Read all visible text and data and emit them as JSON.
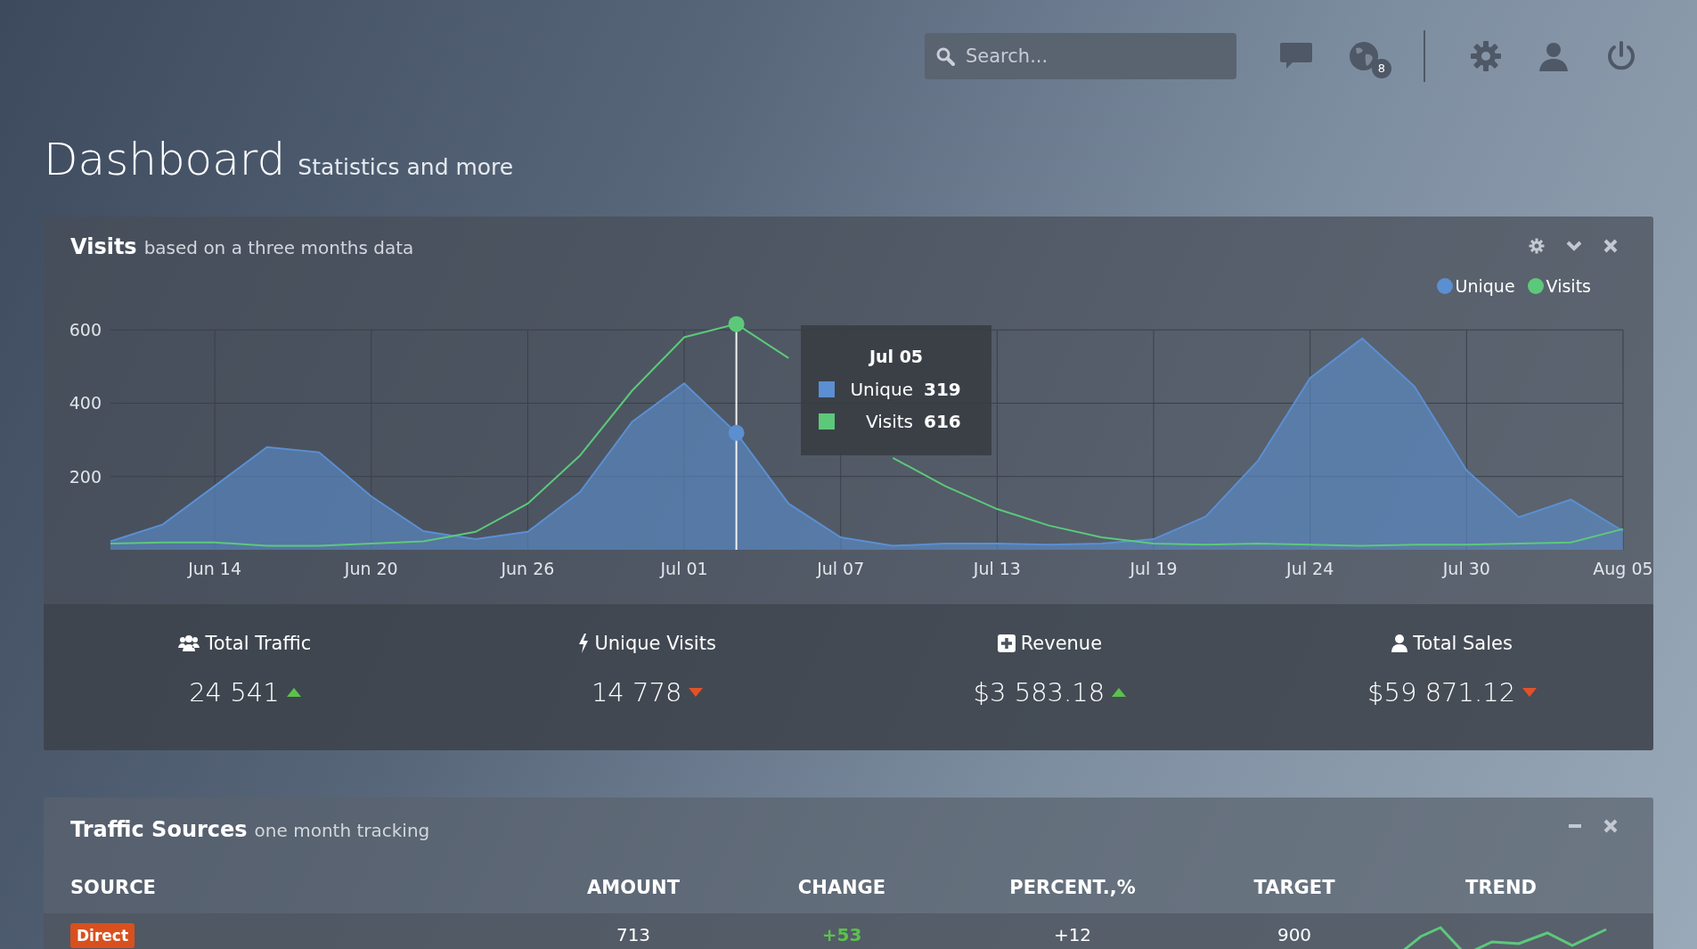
{
  "topbar": {
    "search": {
      "placeholder": "Search..."
    },
    "notifications_badge": "8"
  },
  "header": {
    "title": "Dashboard",
    "subtitle": "Statistics and more"
  },
  "visits_panel": {
    "title": "Visits",
    "subtitle": "based on a three months data",
    "chart_data": {
      "type": "area",
      "categories": [
        null,
        null,
        "Jun 14",
        null,
        null,
        "Jun 20",
        null,
        null,
        "Jun 26",
        null,
        null,
        "Jul 01",
        null,
        null,
        "Jul 07",
        null,
        null,
        "Jul 13",
        null,
        null,
        "Jul 19",
        null,
        null,
        "Jul 24",
        null,
        null,
        "Jul 30",
        null,
        null,
        "Aug 05"
      ],
      "series": [
        {
          "name": "Unique",
          "color": "#5b8fd1",
          "values": [
            23,
            69,
            174,
            280,
            266,
            146,
            51,
            29,
            49,
            157,
            349,
            454,
            319,
            126,
            34,
            11,
            17,
            17,
            14,
            17,
            29,
            91,
            243,
            469,
            577,
            446,
            217,
            89,
            137,
            51
          ]
        },
        {
          "name": "Visits",
          "type": "line",
          "color": "#5cc97a",
          "values": [
            17,
            20,
            20,
            11,
            11,
            17,
            23,
            49,
            126,
            257,
            434,
            580,
            616,
            523,
            null,
            251,
            174,
            111,
            66,
            34,
            17,
            14,
            17,
            14,
            11,
            14,
            14,
            17,
            20,
            57
          ]
        }
      ],
      "ylim": [
        0,
        620
      ],
      "yticks": [
        200,
        400,
        600
      ],
      "grid": true,
      "legend": true,
      "annotations": [
        "Jul 05"
      ]
    },
    "tooltip": {
      "rows": [
        {
          "label": "Unique",
          "value": "319"
        },
        {
          "label": "Visits",
          "value": "616"
        }
      ]
    },
    "stats": [
      {
        "label": "Total Traffic",
        "value": "24 541",
        "up": true
      },
      {
        "label": "Unique Visits",
        "value": "14 778",
        "up": false
      },
      {
        "label": "Revenue",
        "value": "$3 583.18",
        "up": true
      },
      {
        "label": "Total Sales",
        "value": "$59 871.12",
        "up": false
      }
    ]
  },
  "traffic_panel": {
    "title": "Traffic Sources",
    "subtitle": "one month tracking",
    "columns": [
      "SOURCE",
      "AMOUNT",
      "CHANGE",
      "PERCENT.,%",
      "TARGET",
      "TREND"
    ],
    "rows": [
      {
        "source": "Direct",
        "color": "#d9501e",
        "amount": "713",
        "change": "+53",
        "positive": true,
        "percent": "+12",
        "target": "900"
      }
    ]
  }
}
